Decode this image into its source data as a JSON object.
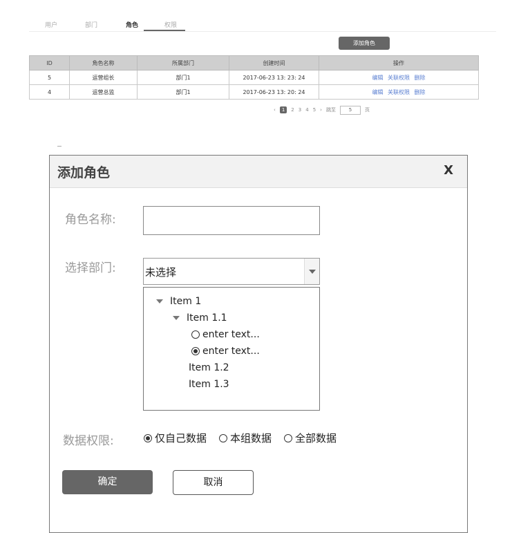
{
  "tabs": [
    "用户",
    "部门",
    "角色",
    "权限"
  ],
  "active_tab_index": 2,
  "add_role_button": "添加角色",
  "table": {
    "headers": [
      "ID",
      "角色名称",
      "所属部门",
      "创建时间",
      "操作"
    ],
    "rows": [
      {
        "id": "5",
        "name": "运营组长",
        "dept": "部门1",
        "created": "2017-06-23 13: 23: 24"
      },
      {
        "id": "4",
        "name": "运营总监",
        "dept": "部门1",
        "created": "2017-06-23 13: 20: 24"
      }
    ],
    "actions": [
      "编辑",
      "关联权限",
      "删除"
    ]
  },
  "pagination": {
    "prev": "‹",
    "pages": [
      "1",
      "2",
      "3",
      "4",
      "5"
    ],
    "current": "1",
    "next": "›",
    "jump_label": "跳至",
    "jump_value": "5",
    "page_unit": "页"
  },
  "dialog": {
    "title": "添加角色",
    "close": "X",
    "role_name_label": "角色名称:",
    "role_name_value": "",
    "dept_label": "选择部门:",
    "dept_selected": "未选择",
    "tree": {
      "item1": "Item 1",
      "item1_1": "Item 1.1",
      "option_a": "enter text...",
      "option_b": "enter text...",
      "item1_2": "Item 1.2",
      "item1_3": "Item 1.3"
    },
    "tree_selected_option": "option_b",
    "data_perm_label": "数据权限:",
    "data_perm_options": [
      "仅自己数据",
      "本组数据",
      "全部数据"
    ],
    "data_perm_selected": 0,
    "ok_button": "确定",
    "cancel_button": "取消"
  }
}
